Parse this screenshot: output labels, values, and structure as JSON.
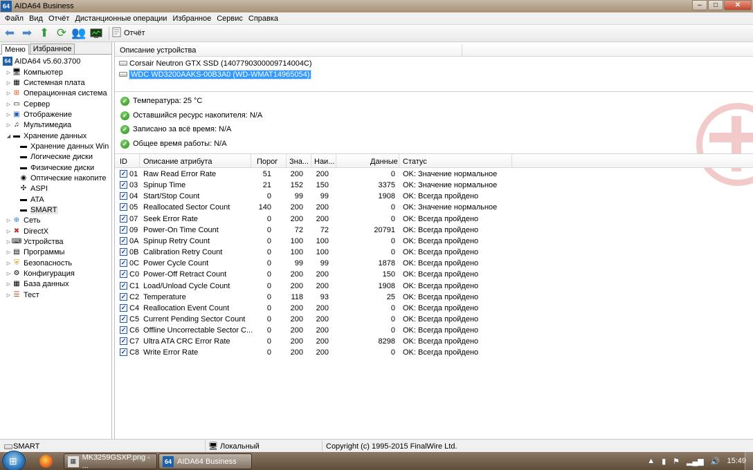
{
  "window": {
    "title": "AIDA64 Business",
    "app_icon": "64",
    "minimize": "–",
    "maximize": "□",
    "close": "✕"
  },
  "menu": [
    "Файл",
    "Вид",
    "Отчёт",
    "Дистанционные операции",
    "Избранное",
    "Сервис",
    "Справка"
  ],
  "toolbar": {
    "report_label": "Отчёт",
    "icons": [
      "back-arrow-icon",
      "forward-arrow-icon",
      "up-arrow-icon",
      "refresh-icon",
      "users-icon",
      "monitor-icon",
      "report-icon"
    ]
  },
  "sidebar": {
    "tabs": [
      "Меню",
      "Избранное"
    ],
    "root": "AIDA64 v5.60.3700",
    "items": [
      {
        "label": "Компьютер",
        "icon": "computer-icon"
      },
      {
        "label": "Системная плата",
        "icon": "motherboard-icon"
      },
      {
        "label": "Операционная система",
        "icon": "windows-icon"
      },
      {
        "label": "Сервер",
        "icon": "server-icon"
      },
      {
        "label": "Отображение",
        "icon": "display-icon"
      },
      {
        "label": "Мультимедиа",
        "icon": "multimedia-icon"
      },
      {
        "label": "Хранение данных",
        "icon": "storage-icon"
      },
      {
        "label": "Хранение данных Win",
        "icon": "storage-icon"
      },
      {
        "label": "Логические диски",
        "icon": "drive-icon"
      },
      {
        "label": "Физические диски",
        "icon": "drive-icon"
      },
      {
        "label": "Оптические накопите",
        "icon": "optical-drive-icon"
      },
      {
        "label": "ASPI",
        "icon": "aspi-icon"
      },
      {
        "label": "ATA",
        "icon": "drive-icon"
      },
      {
        "label": "SMART",
        "icon": "drive-icon"
      },
      {
        "label": "Сеть",
        "icon": "network-icon"
      },
      {
        "label": "DirectX",
        "icon": "directx-icon"
      },
      {
        "label": "Устройства",
        "icon": "devices-icon"
      },
      {
        "label": "Программы",
        "icon": "programs-icon"
      },
      {
        "label": "Безопасность",
        "icon": "security-icon"
      },
      {
        "label": "Конфигурация",
        "icon": "config-icon"
      },
      {
        "label": "База данных",
        "icon": "database-icon"
      },
      {
        "label": "Тест",
        "icon": "test-icon"
      }
    ]
  },
  "devices": {
    "header": "Описание устройства",
    "list": [
      "Corsair Neutron GTX SSD (1407790300009714004C)",
      "WDC WD3200AAKS-00B3A0 (WD-WMAT14965054)"
    ]
  },
  "summary": [
    "Температура: 25 °C",
    "Оставшийся ресурс накопителя: N/A",
    "Записано за всё время: N/A",
    "Общее время работы: N/A"
  ],
  "smart": {
    "columns": [
      "ID",
      "Описание атрибута",
      "Порог",
      "Зна...",
      "Наи...",
      "Данные",
      "Статус"
    ],
    "rows": [
      {
        "id": "01",
        "desc": "Raw Read Error Rate",
        "thr": "51",
        "val": "200",
        "worst": "200",
        "data": "0",
        "status": "OK: Значение нормальное"
      },
      {
        "id": "03",
        "desc": "Spinup Time",
        "thr": "21",
        "val": "152",
        "worst": "150",
        "data": "3375",
        "status": "OK: Значение нормальное"
      },
      {
        "id": "04",
        "desc": "Start/Stop Count",
        "thr": "0",
        "val": "99",
        "worst": "99",
        "data": "1908",
        "status": "OK: Всегда пройдено"
      },
      {
        "id": "05",
        "desc": "Reallocated Sector Count",
        "thr": "140",
        "val": "200",
        "worst": "200",
        "data": "0",
        "status": "OK: Значение нормальное"
      },
      {
        "id": "07",
        "desc": "Seek Error Rate",
        "thr": "0",
        "val": "200",
        "worst": "200",
        "data": "0",
        "status": "OK: Всегда пройдено"
      },
      {
        "id": "09",
        "desc": "Power-On Time Count",
        "thr": "0",
        "val": "72",
        "worst": "72",
        "data": "20791",
        "status": "OK: Всегда пройдено"
      },
      {
        "id": "0A",
        "desc": "Spinup Retry Count",
        "thr": "0",
        "val": "100",
        "worst": "100",
        "data": "0",
        "status": "OK: Всегда пройдено"
      },
      {
        "id": "0B",
        "desc": "Calibration Retry Count",
        "thr": "0",
        "val": "100",
        "worst": "100",
        "data": "0",
        "status": "OK: Всегда пройдено"
      },
      {
        "id": "0C",
        "desc": "Power Cycle Count",
        "thr": "0",
        "val": "99",
        "worst": "99",
        "data": "1878",
        "status": "OK: Всегда пройдено"
      },
      {
        "id": "C0",
        "desc": "Power-Off Retract Count",
        "thr": "0",
        "val": "200",
        "worst": "200",
        "data": "150",
        "status": "OK: Всегда пройдено"
      },
      {
        "id": "C1",
        "desc": "Load/Unload Cycle Count",
        "thr": "0",
        "val": "200",
        "worst": "200",
        "data": "1908",
        "status": "OK: Всегда пройдено"
      },
      {
        "id": "C2",
        "desc": "Temperature",
        "thr": "0",
        "val": "118",
        "worst": "93",
        "data": "25",
        "status": "OK: Всегда пройдено"
      },
      {
        "id": "C4",
        "desc": "Reallocation Event Count",
        "thr": "0",
        "val": "200",
        "worst": "200",
        "data": "0",
        "status": "OK: Всегда пройдено"
      },
      {
        "id": "C5",
        "desc": "Current Pending Sector Count",
        "thr": "0",
        "val": "200",
        "worst": "200",
        "data": "0",
        "status": "OK: Всегда пройдено"
      },
      {
        "id": "C6",
        "desc": "Offline Uncorrectable Sector C...",
        "thr": "0",
        "val": "200",
        "worst": "200",
        "data": "0",
        "status": "OK: Всегда пройдено"
      },
      {
        "id": "C7",
        "desc": "Ultra ATA CRC Error Rate",
        "thr": "0",
        "val": "200",
        "worst": "200",
        "data": "8298",
        "status": "OK: Всегда пройдено"
      },
      {
        "id": "C8",
        "desc": "Write Error Rate",
        "thr": "0",
        "val": "200",
        "worst": "200",
        "data": "0",
        "status": "OK: Всегда пройдено"
      }
    ]
  },
  "statusbar": {
    "left": "SMART",
    "middle": "Локальный",
    "right": "Copyright (c) 1995-2015 FinalWire Ltd."
  },
  "taskbar": {
    "tasks": [
      {
        "label": "MK3259GSXP.png - ...",
        "active": false
      },
      {
        "label": "AIDA64 Business",
        "active": true
      }
    ],
    "clock": "15:49"
  }
}
